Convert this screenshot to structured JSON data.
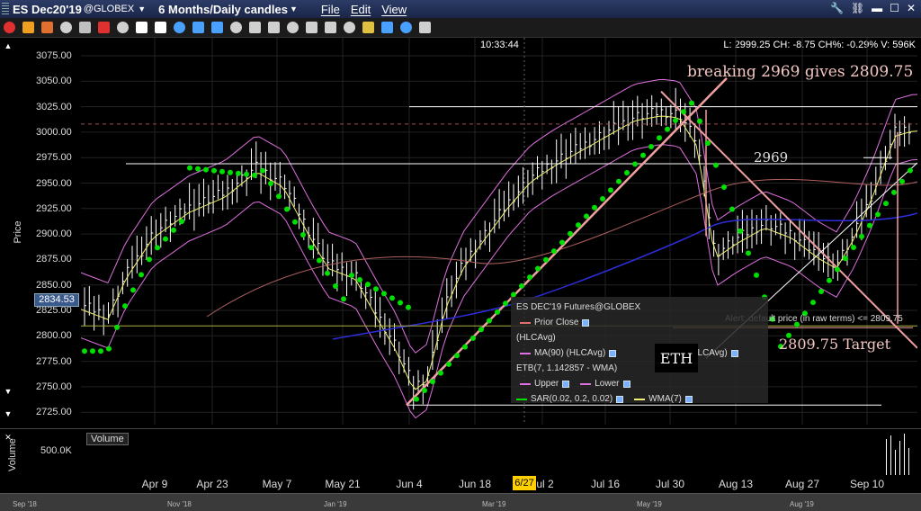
{
  "window": {
    "symbol": "ES Dec20'19",
    "exchange": "@GLOBEX",
    "period": "6 Months/Daily candles",
    "menus": [
      "File",
      "Edit",
      "View"
    ]
  },
  "toolbar_icons": [
    "cursor-icon",
    "crosshair-icon",
    "pen-icon",
    "undo-icon",
    "circle-icon",
    "draw-icon",
    "settings-icon",
    "bar-icon",
    "grid-icon",
    "hand-icon",
    "rotate-icon",
    "line-icon",
    "text-icon",
    "eraser-icon",
    "fib-icon",
    "zoom-in-icon",
    "zoom-out-icon",
    "reset-icon",
    "expand-icon",
    "print-icon",
    "save-icon",
    "link-icon",
    "lock-icon"
  ],
  "info_line": "L: 2999.25  CH: -8.75   CH%: -0.29%  V: 596K",
  "time": "10:33:44",
  "price_axis": {
    "label": "Price",
    "ticks": [
      "3075.00",
      "3050.00",
      "3025.00",
      "3000.00",
      "2975.00",
      "2950.00",
      "2925.00",
      "2900.00",
      "2875.00",
      "2850.00",
      "2825.00",
      "2800.00",
      "2775.00",
      "2750.00",
      "2725.00"
    ],
    "current_price": "2834.53"
  },
  "annotations": {
    "headline": "breaking 2969 gives 2809.75",
    "level": "2969",
    "target": "2809.75 Target",
    "alert": "Alert: default price (in raw terms) <= 2809.75",
    "eth": "ETH"
  },
  "legend": {
    "title": "ES DEC'19 Futures@GLOBEX",
    "prior_close": "Prior Close",
    "hlc": "(HLCAvg)",
    "ma": "MA(90) (HLCAvg)",
    "ma2": "3) (HLCAvg)",
    "etb": "ETB(7, 1.142857 - WMA)",
    "upper": "Upper",
    "lower": "Lower",
    "sar": "SAR(0.02, 0.2, 0.02)",
    "wma": "WMA(7)"
  },
  "volume": {
    "axis_label": "Volume",
    "title": "Volume",
    "tick": "500.0K"
  },
  "x_axis": {
    "ticks": [
      "Apr 9",
      "Apr 23",
      "May 7",
      "May 21",
      "Jun 4",
      "Jun 18",
      "Jul 2",
      "Jul 16",
      "Jul 30",
      "Aug 13",
      "Aug 27",
      "Sep 10"
    ],
    "cursor_date": "6/27"
  },
  "overview": [
    "Sep '18",
    "Nov '18",
    "Jan '19",
    "Mar '19",
    "May '19",
    "Aug '19"
  ],
  "colors": {
    "sar": "#00e000",
    "bands": "#e070e0",
    "wma": "#f0f070",
    "ma": "#2d2dd8",
    "ma_slow": "#b06060",
    "trend": "#f0a0a0",
    "white": "#ffffff"
  },
  "chart_data": {
    "type": "candlestick",
    "x": [
      "Apr 9",
      "Apr 23",
      "May 7",
      "May 21",
      "Jun 4",
      "Jun 18",
      "Jul 2",
      "Jul 16",
      "Jul 30",
      "Aug 13",
      "Aug 27",
      "Sep 10"
    ],
    "ylim": [
      2725,
      3075
    ],
    "approx_close": [
      2880,
      2925,
      2960,
      2830,
      2745,
      2905,
      2960,
      3010,
      3020,
      2880,
      2890,
      3005
    ],
    "levels": {
      "resistance": 3025,
      "breakout": 2969,
      "prior_close": 3008,
      "target": 2809.75
    }
  }
}
